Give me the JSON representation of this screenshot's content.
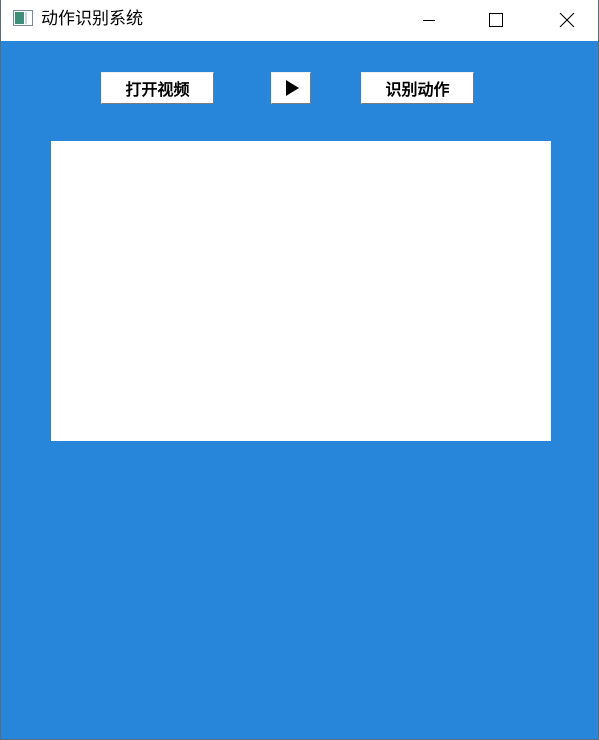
{
  "window": {
    "title": "动作识别系统",
    "app_icon": "app-window-icon",
    "controls": {
      "minimize_icon": "minimize-icon",
      "maximize_icon": "maximize-icon",
      "close_icon": "close-icon"
    }
  },
  "toolbar": {
    "open_video_label": "打开视频",
    "play_icon": "play-icon",
    "recognize_label": "识别动作"
  },
  "colors": {
    "background": "#2786da",
    "video_area": "#ffffff"
  }
}
